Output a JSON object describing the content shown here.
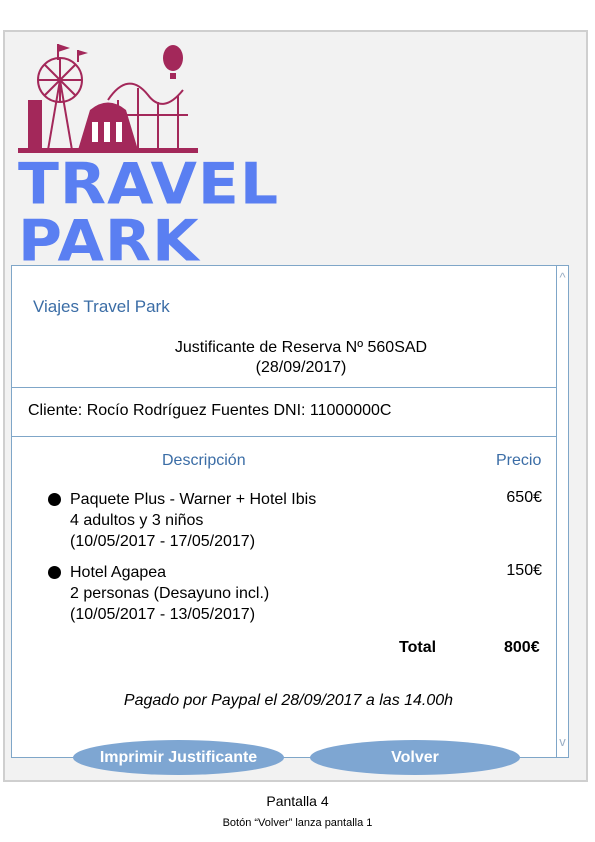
{
  "logo": {
    "text": "TRAVEL PARK",
    "icon": "amusement-park-logo",
    "color": "#5a7ff2",
    "art_color": "#a3285a"
  },
  "receipt": {
    "company": "Viajes Travel Park",
    "title": "Justificante de Reserva Nº 560SAD",
    "date": "(28/09/2017)",
    "client": "Cliente: Rocío Rodríguez Fuentes  DNI: 11000000C",
    "columns": {
      "description": "Descripción",
      "price": "Precio"
    },
    "items": [
      {
        "line1": "Paquete Plus - Warner + Hotel Ibis",
        "line2": "4 adultos y 3 niños",
        "line3": "(10/05/2017 - 17/05/2017)",
        "price": "650€"
      },
      {
        "line1": "Hotel Agapea",
        "line2": "2 personas (Desayuno incl.)",
        "line3": "(10/05/2017 - 13/05/2017)",
        "price": "150€"
      }
    ],
    "total_label": "Total",
    "total_value": "800€",
    "paid": "Pagado por Paypal el 28/09/2017 a las 14.00h"
  },
  "scroll": {
    "up": "^",
    "down": "v"
  },
  "buttons": {
    "print": "Imprimir Justificante",
    "back": "Volver"
  },
  "colors": {
    "accent": "#3b6da6",
    "button": "#7ea6d2",
    "panel_border": "#7fa6c8"
  },
  "caption": "Pantalla 4",
  "note": "Botón “Volver” lanza pantalla 1"
}
